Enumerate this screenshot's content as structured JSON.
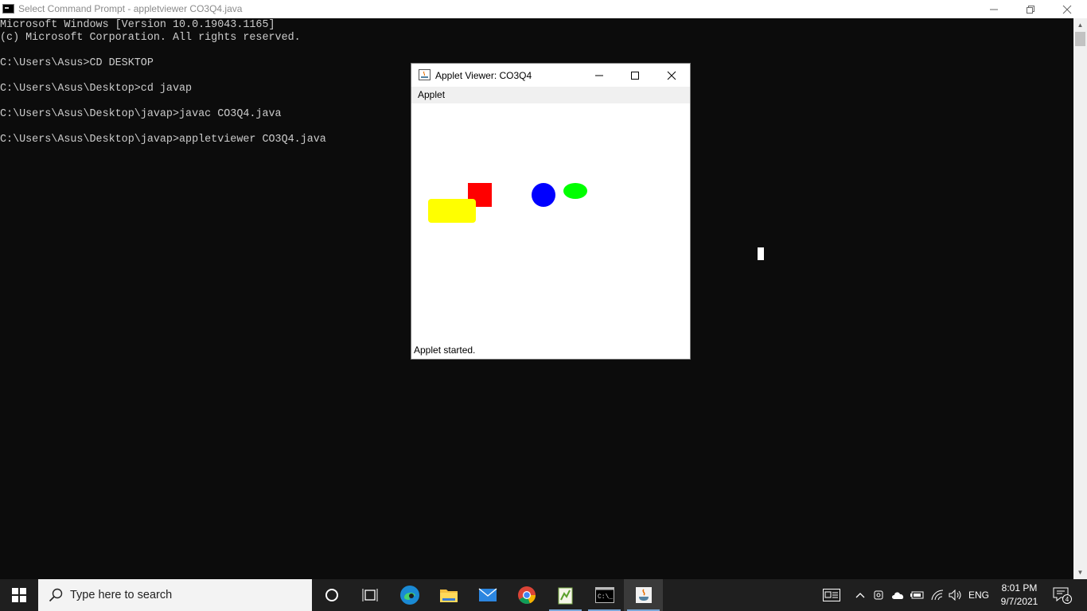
{
  "cmd_window": {
    "title": "Select Command Prompt - appletviewer  CO3Q4.java",
    "lines": [
      "Microsoft Windows [Version 10.0.19043.1165]",
      "(c) Microsoft Corporation. All rights reserved.",
      "",
      "C:\\Users\\Asus>CD DESKTOP",
      "",
      "C:\\Users\\Asus\\Desktop>cd javap",
      "",
      "C:\\Users\\Asus\\Desktop\\javap>javac CO3Q4.java",
      "",
      "C:\\Users\\Asus\\Desktop\\javap>appletviewer CO3Q4.java"
    ],
    "controls": {
      "minimize": "—",
      "restore": "❐",
      "close": "✕"
    }
  },
  "applet_window": {
    "title": "Applet Viewer: CO3Q4",
    "menu": "Applet",
    "status": "Applet started.",
    "shapes": {
      "red_square": "#ff0000",
      "yellow_rounded_rect": "#ffff00",
      "blue_circle": "#0000ff",
      "green_ellipse": "#00ff00"
    }
  },
  "taskbar": {
    "search_placeholder": "Type here to search",
    "apps": [
      "cortana",
      "task-view",
      "edge",
      "file-explorer",
      "mail",
      "chrome",
      "notepad-plus",
      "command-prompt",
      "java-applet"
    ],
    "tray": {
      "language": "ENG",
      "time": "8:01 PM",
      "date": "9/7/2021",
      "notification_count": "4"
    }
  }
}
